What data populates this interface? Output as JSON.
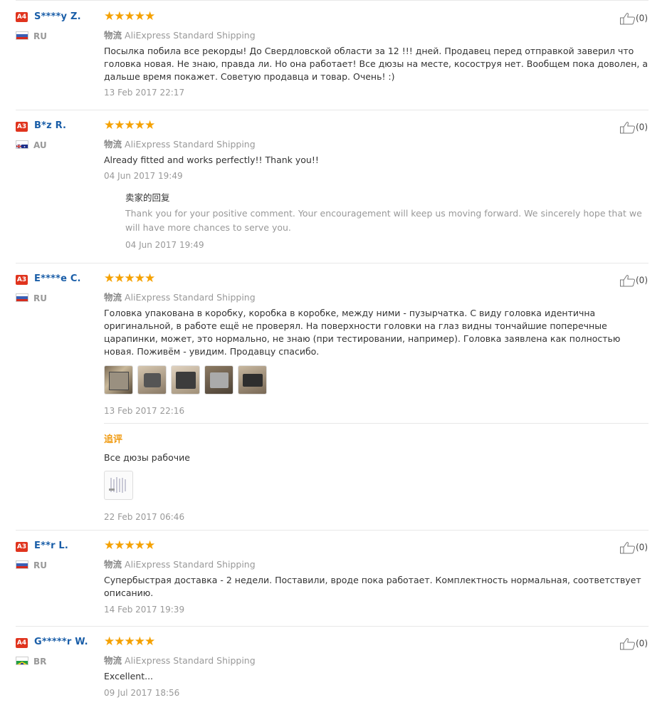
{
  "ship_prefix": "物流",
  "reviews": [
    {
      "level": "A4",
      "name": "S****y Z.",
      "country": "RU",
      "stars": "★★★★★",
      "shipping": "AliExpress Standard Shipping",
      "text": "Посылка побила все рекорды! До Свердловской области за 12 !!! дней. Продавец перед отправкой заверил что головка новая. Не знаю, правда ли. Но она работает! Все дюзы на месте, косоструя нет. Вообщем пока доволен, а дальше время покажет. Советую продавца и товар. Очень! :)",
      "date": "13 Feb 2017 22:17",
      "likes": "(0)"
    },
    {
      "level": "A3",
      "name": "B*z R.",
      "country": "AU",
      "stars": "★★★★★",
      "shipping": "AliExpress Standard Shipping",
      "text": "Already fitted and works perfectly!! Thank you!!",
      "date": "04 Jun 2017 19:49",
      "likes": "(0)",
      "reply": {
        "title": "卖家的回复",
        "text": "Thank you for your positive comment. Your encouragement will keep us moving forward. We sincerely hope that we will have more chances to serve you.",
        "date": "04 Jun 2017 19:49"
      }
    },
    {
      "level": "A3",
      "name": "E****e C.",
      "country": "RU",
      "stars": "★★★★★",
      "shipping": "AliExpress Standard Shipping",
      "text": "Головка упакована в коробку, коробка в коробке, между ними - пузырчатка. С виду головка идентична оригинальной, в работе ещё не проверял. На поверхности головки на глаз видны тончайшие поперечные царапинки, может, это нормально, не знаю (при тестировании, например). Головка заявлена как полностью новая. Поживём - увидим. Продавцу спасибо.",
      "date": "13 Feb 2017 22:16",
      "likes": "(0)",
      "followup": {
        "label": "追评",
        "text": "Все дюзы рабочие",
        "date": "22 Feb 2017 06:46"
      }
    },
    {
      "level": "A3",
      "name": "E**r L.",
      "country": "RU",
      "stars": "★★★★★",
      "shipping": "AliExpress Standard Shipping",
      "text": "Супербыстрая доставка - 2 недели. Поставили, вроде пока работает. Комплектность нормальная, соответствует описанию.",
      "date": "14 Feb 2017 19:39",
      "likes": "(0)"
    },
    {
      "level": "A4",
      "name": "G*****r W.",
      "country": "BR",
      "stars": "★★★★★",
      "shipping": "AliExpress Standard Shipping",
      "text": "Excellent...",
      "date": "09 Jul 2017 18:56",
      "likes": "(0)"
    }
  ],
  "colors": {
    "star": "#f5a100",
    "name": "#1a5ea8",
    "badge": "#e0341e",
    "followup": "#f09b12"
  }
}
